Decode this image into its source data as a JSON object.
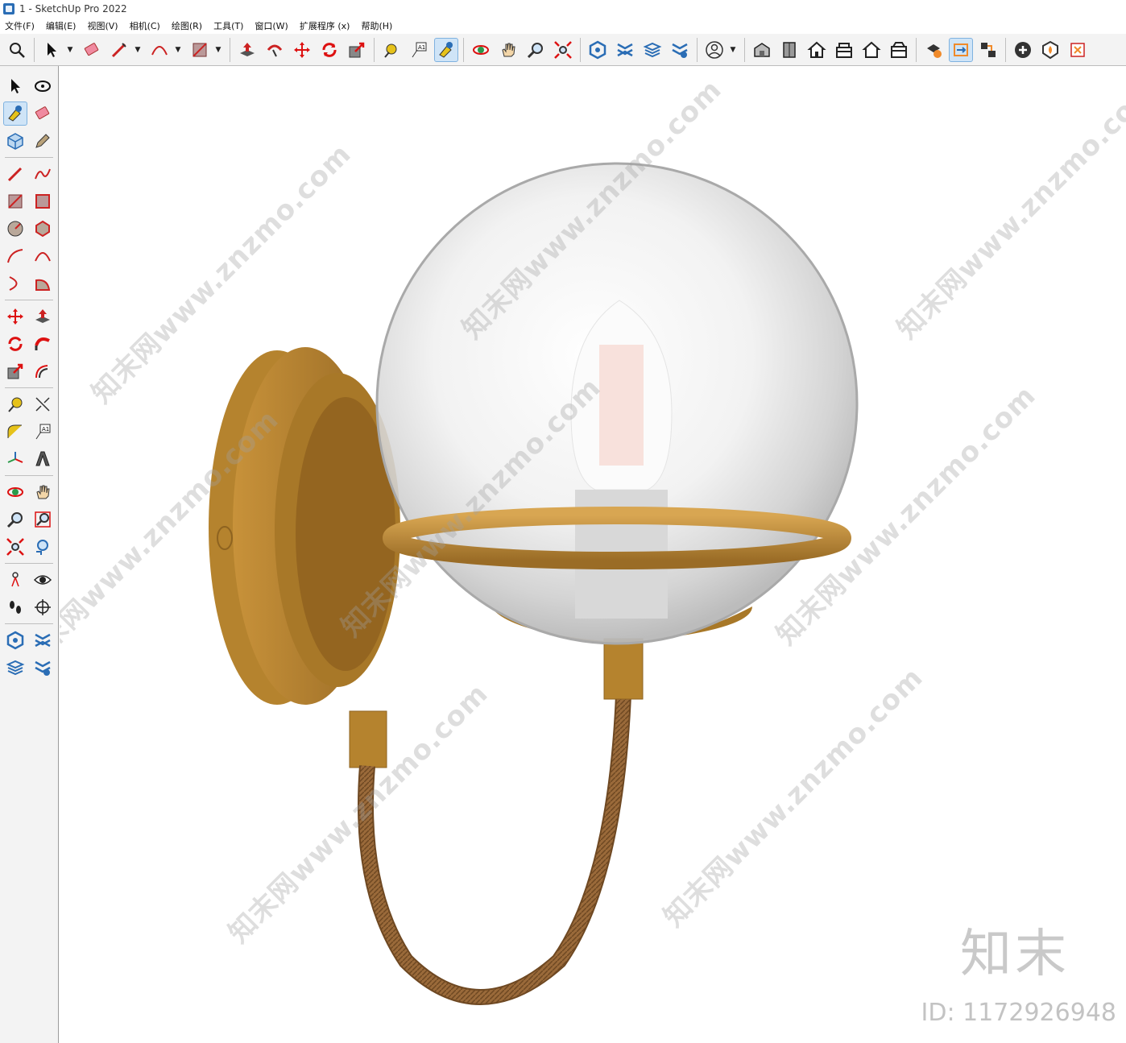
{
  "window": {
    "title": "1 - SketchUp Pro 2022"
  },
  "menu": [
    "文件(F)",
    "编辑(E)",
    "视图(V)",
    "相机(C)",
    "绘图(R)",
    "工具(T)",
    "窗口(W)",
    "扩展程序 (x)",
    "帮助(H)"
  ],
  "toolbar": {
    "icons": [
      "search-icon",
      "select-icon",
      "eraser-icon",
      "pencil-icon",
      "arc-icon",
      "rectangle-icon",
      "pushpull-icon",
      "followme-icon",
      "move-icon",
      "rotate-icon",
      "scale-icon",
      "tape-icon",
      "text-icon",
      "paint-icon",
      "orbit-icon",
      "pan-icon",
      "zoom-icon",
      "zoom-extents-icon",
      "warehouse-icon",
      "extension-warehouse-icon",
      "layout-icon",
      "extension-manager-icon",
      "profile-icon",
      "iso-view-icon",
      "top-view-icon",
      "front-view-icon",
      "right-view-icon",
      "back-view-icon",
      "left-view-icon",
      "solid-tools-icon",
      "section-icon",
      "scenes-icon",
      "add-icon",
      "shield-icon",
      "ruby-icon"
    ]
  },
  "left_toolbar": {
    "icons": [
      "select-icon",
      "orbit-icon",
      "paint-icon",
      "eraser-icon",
      "component-icon",
      "tag-icon",
      "pencil-icon",
      "freehand-icon",
      "rectangle-icon",
      "rotated-rect-icon",
      "circle-icon",
      "polygon-icon",
      "arc-icon",
      "arc-2pt-icon",
      "arc-3pt-icon",
      "pie-icon",
      "move-icon",
      "pushpull-icon",
      "rotate-icon",
      "followme-icon",
      "scale-icon",
      "offset-icon",
      "tape-icon",
      "dimension-icon",
      "protractor-icon",
      "text-icon",
      "axes-icon",
      "3dtext-icon",
      "orbit-icon",
      "pan-icon",
      "zoom-icon",
      "zoom-window-icon",
      "zoom-extents-icon",
      "previous-view-icon",
      "position-camera-icon",
      "look-around-icon",
      "walk-icon",
      "section-plane-icon",
      "warehouse-icon",
      "extension-warehouse-icon",
      "layout-icon",
      "extension-manager-icon"
    ]
  },
  "watermark": {
    "text": "知末网www.znzmo.com",
    "brand": "知末",
    "id_label": "ID: 1172926948"
  },
  "colors": {
    "brass": "#b5832e",
    "brass_dark": "#8e6320",
    "glass": "#e8e8e8",
    "cord": "#9a6a3a",
    "toolbar_bg": "#f3f3f3",
    "active_bg": "#cfe4f7"
  }
}
